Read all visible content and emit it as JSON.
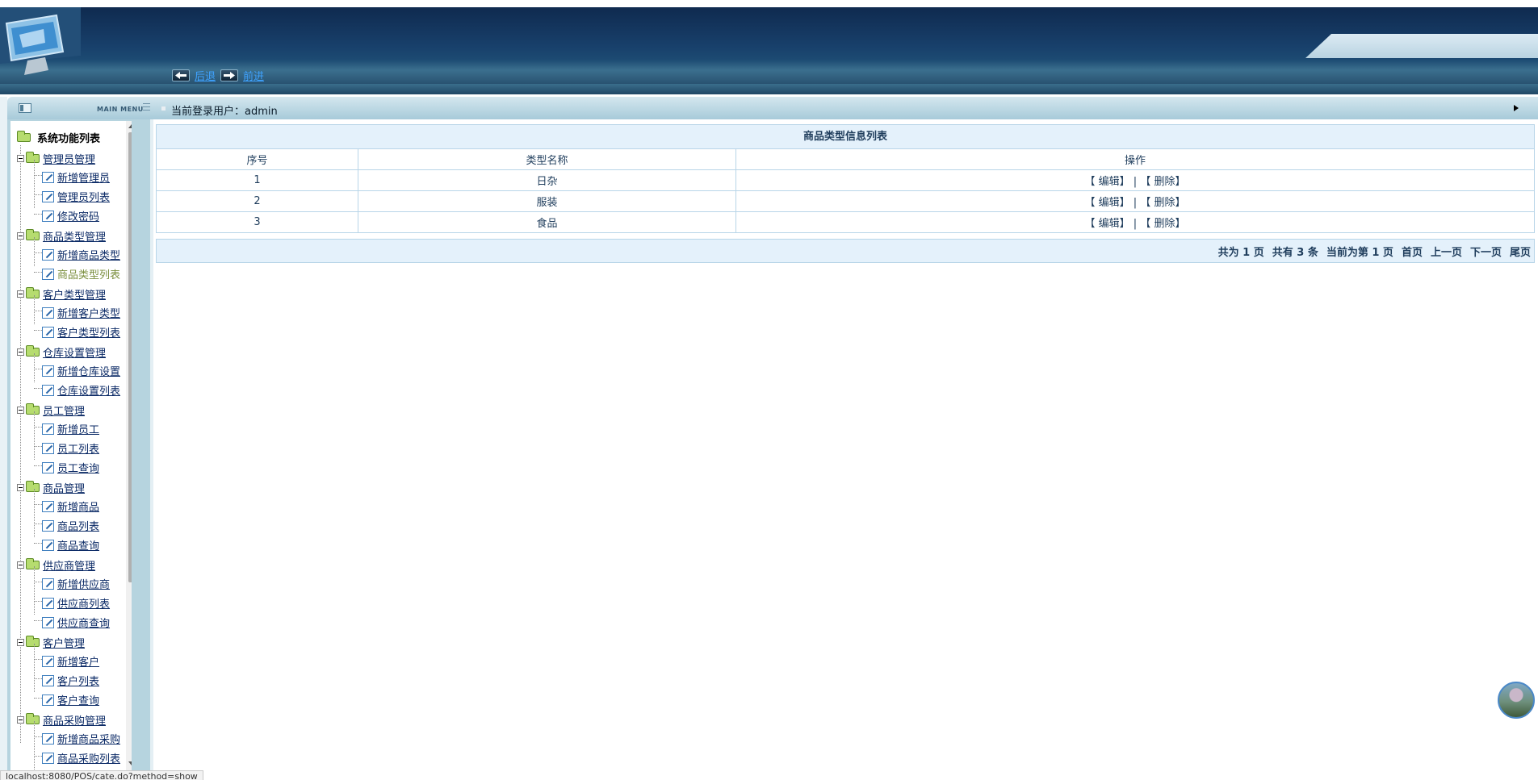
{
  "header": {
    "back_label": "后退",
    "forward_label": "前进"
  },
  "sidebar": {
    "main_menu_label": "MAIN MENU",
    "root_label": "系统功能列表",
    "groups": [
      {
        "label": "管理员管理",
        "children": [
          "新增管理员",
          "管理员列表",
          "修改密码"
        ]
      },
      {
        "label": "商品类型管理",
        "children": [
          "新增商品类型",
          "商品类型列表"
        ]
      },
      {
        "label": "客户类型管理",
        "children": [
          "新增客户类型",
          "客户类型列表"
        ]
      },
      {
        "label": "仓库设置管理",
        "children": [
          "新增仓库设置",
          "仓库设置列表"
        ]
      },
      {
        "label": "员工管理",
        "children": [
          "新增员工",
          "员工列表",
          "员工查询"
        ]
      },
      {
        "label": "商品管理",
        "children": [
          "新增商品",
          "商品列表",
          "商品查询"
        ]
      },
      {
        "label": "供应商管理",
        "children": [
          "新增供应商",
          "供应商列表",
          "供应商查询"
        ]
      },
      {
        "label": "客户管理",
        "children": [
          "新增客户",
          "客户列表",
          "客户查询"
        ]
      },
      {
        "label": "商品采购管理",
        "children": [
          "新增商品采购",
          "商品采购列表"
        ]
      }
    ],
    "current_item": "商品类型列表"
  },
  "main": {
    "user_label": "当前登录用户：admin",
    "table": {
      "caption": "商品类型信息列表",
      "headers": [
        "序号",
        "类型名称",
        "操作"
      ],
      "rows": [
        {
          "no": "1",
          "name": "日杂"
        },
        {
          "no": "2",
          "name": "服装"
        },
        {
          "no": "3",
          "name": "食品"
        }
      ],
      "edit_label": "【 编辑】",
      "separator": "|",
      "delete_label": "【 删除】"
    },
    "pager": {
      "total_pages": "共为 1 页",
      "total_records": "共有 3 条",
      "current_page": "当前为第 1 页",
      "first": "首页",
      "prev": "上一页",
      "next": "下一页",
      "last": "尾页"
    }
  },
  "status_bar": {
    "url": "localhost:8080/POS/cate.do?method=show"
  },
  "colors": {
    "header_dark": "#0f2a4f",
    "panel_bar": "#a7cad9",
    "table_border": "#b8d5e8",
    "table_header_bg": "#e4f1fb",
    "link_blue": "#3fa3ff"
  }
}
